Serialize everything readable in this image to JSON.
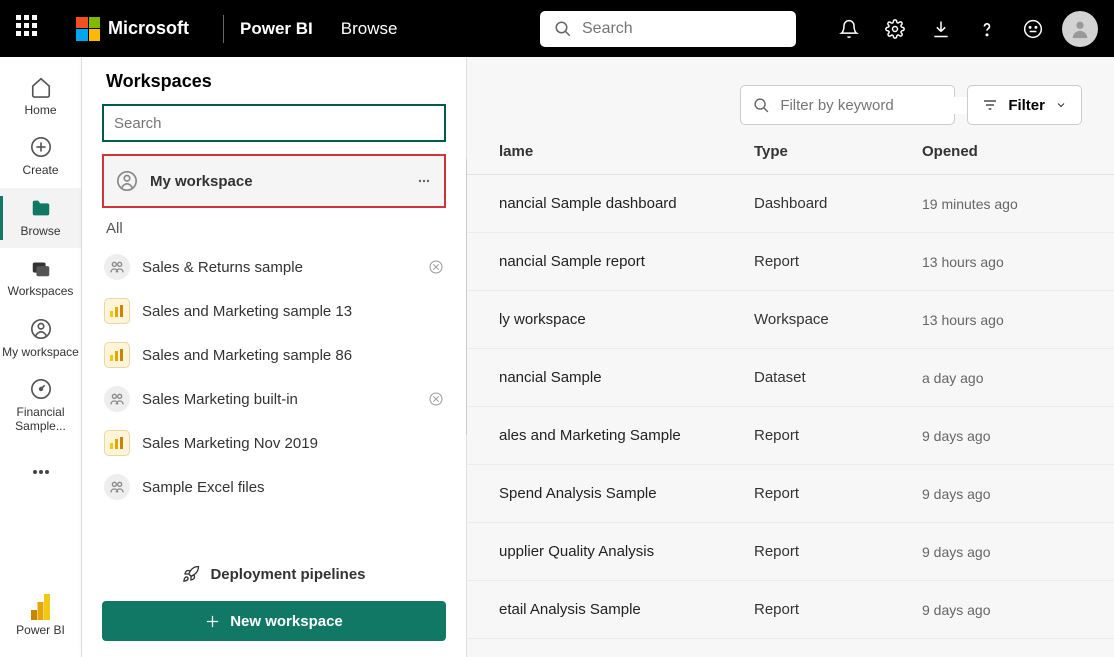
{
  "header": {
    "org": "Microsoft",
    "product": "Power BI",
    "crumb": "Browse",
    "search_placeholder": "Search"
  },
  "nav": {
    "home": "Home",
    "create": "Create",
    "browse": "Browse",
    "workspaces": "Workspaces",
    "my_workspace": "My workspace",
    "financial": "Financial Sample...",
    "power_bi": "Power BI"
  },
  "workspaces_panel": {
    "title": "Workspaces",
    "search_placeholder": "Search",
    "highlighted": "My workspace",
    "all_label": "All",
    "items": [
      {
        "label": "Sales & Returns sample",
        "icon": "people",
        "has_trail": true
      },
      {
        "label": "Sales and Marketing sample 13",
        "icon": "app",
        "has_trail": false
      },
      {
        "label": "Sales and Marketing sample 86",
        "icon": "app",
        "has_trail": false
      },
      {
        "label": "Sales Marketing built-in",
        "icon": "people",
        "has_trail": true
      },
      {
        "label": "Sales Marketing Nov 2019",
        "icon": "app",
        "has_trail": false
      },
      {
        "label": "Sample Excel files",
        "icon": "people",
        "has_trail": false
      }
    ],
    "deployment": "Deployment pipelines",
    "new_workspace": "New workspace"
  },
  "content": {
    "filter_placeholder": "Filter by keyword",
    "filter_button": "Filter",
    "columns": {
      "name": "lame",
      "type": "Type",
      "opened": "Opened"
    },
    "rows": [
      {
        "name": "nancial Sample dashboard",
        "type": "Dashboard",
        "opened": "19 minutes ago"
      },
      {
        "name": "nancial Sample report",
        "type": "Report",
        "opened": "13 hours ago"
      },
      {
        "name": "ly workspace",
        "type": "Workspace",
        "opened": "13 hours ago"
      },
      {
        "name": "nancial Sample",
        "type": "Dataset",
        "opened": "a day ago"
      },
      {
        "name": "ales and Marketing Sample",
        "type": "Report",
        "opened": "9 days ago"
      },
      {
        "name": "Spend Analysis Sample",
        "type": "Report",
        "opened": "9 days ago"
      },
      {
        "name": "upplier Quality Analysis",
        "type": "Report",
        "opened": "9 days ago"
      },
      {
        "name": "etail Analysis Sample",
        "type": "Report",
        "opened": "9 days ago"
      }
    ]
  }
}
